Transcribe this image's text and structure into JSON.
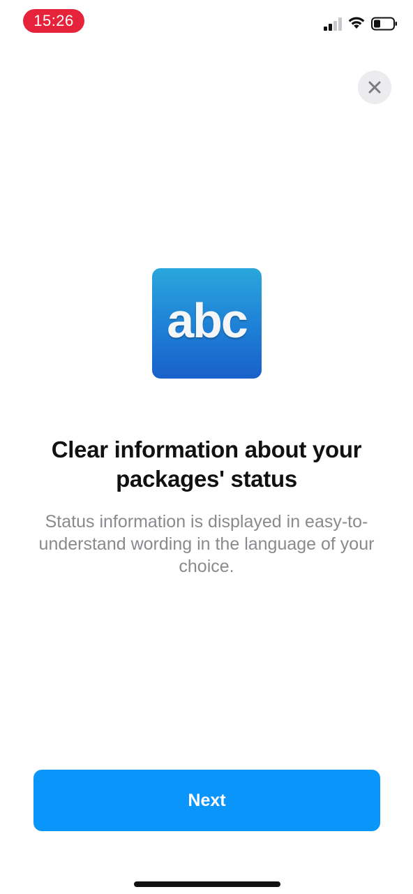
{
  "status_bar": {
    "time": "15:26",
    "time_pill_color": "#e5243b",
    "signal_icon": "cellular-signal-icon",
    "wifi_icon": "wifi-icon",
    "battery_icon": "battery-icon"
  },
  "close_button": {
    "icon": "close-icon"
  },
  "feature": {
    "icon_text": "abc",
    "title": "Clear information about your packages' status",
    "description": "Status information is displayed in easy-to-understand wording in the language of your choice."
  },
  "actions": {
    "next_label": "Next",
    "accent_color": "#0a95fb"
  }
}
